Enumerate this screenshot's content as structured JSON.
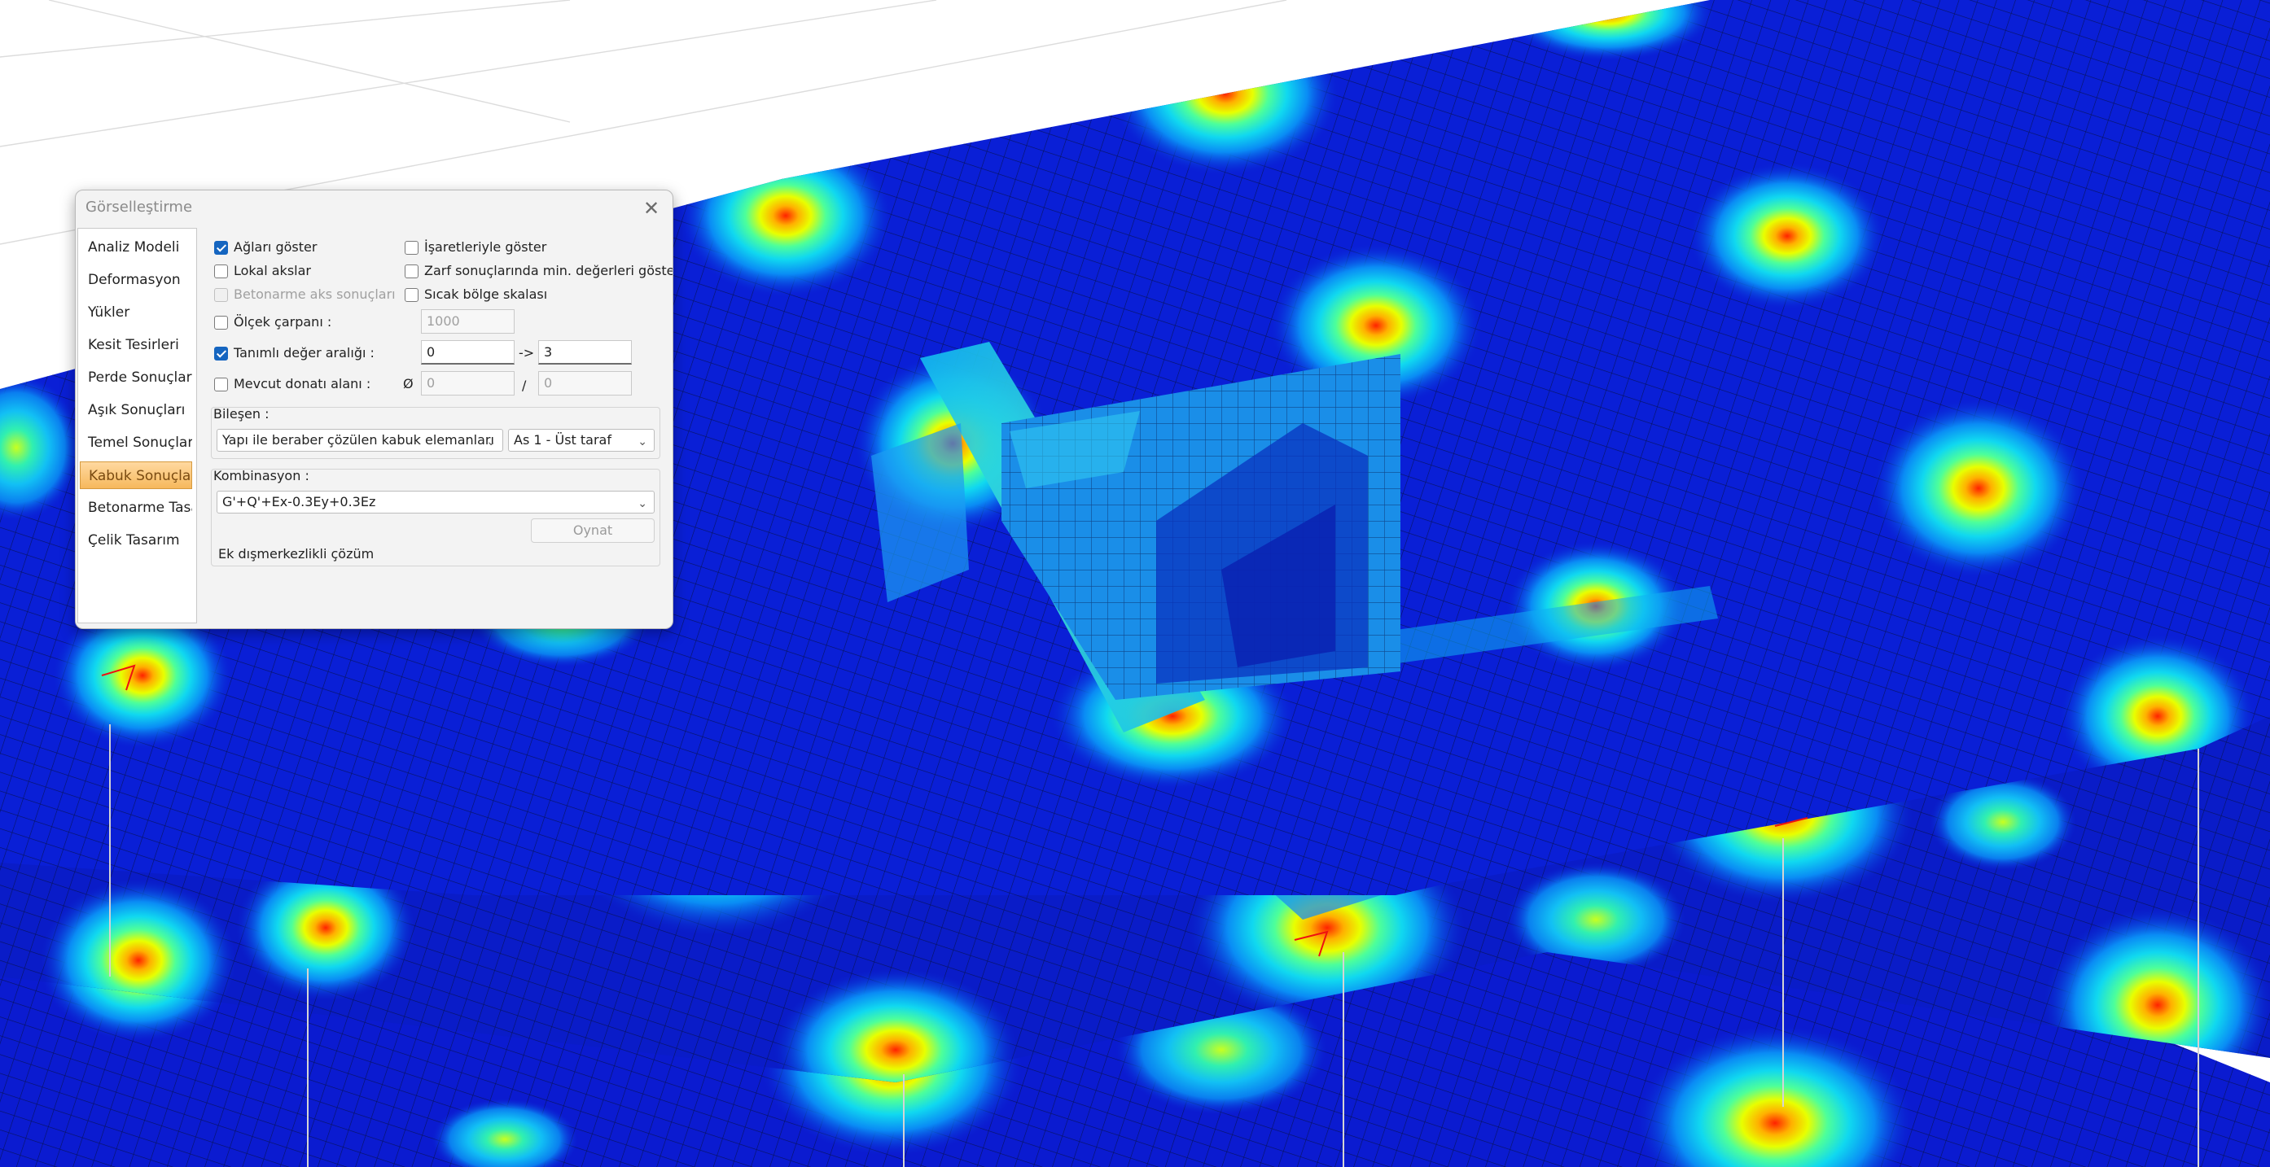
{
  "dialog": {
    "title": "Görselleştirme",
    "close_icon": "close-icon",
    "nav": [
      {
        "label": "Analiz Modeli",
        "active": false
      },
      {
        "label": "Deformasyon",
        "active": false
      },
      {
        "label": "Yükler",
        "active": false
      },
      {
        "label": "Kesit Tesirleri",
        "active": false
      },
      {
        "label": "Perde Sonuçları",
        "active": false
      },
      {
        "label": "Aşık Sonuçları",
        "active": false
      },
      {
        "label": "Temel Sonuçları",
        "active": false
      },
      {
        "label": "Kabuk Sonuçları",
        "active": true
      },
      {
        "label": "Betonarme Tasarım",
        "active": false
      },
      {
        "label": "Çelik Tasarım",
        "active": false
      }
    ],
    "options": {
      "show_mesh": {
        "label": "Ağları göster",
        "checked": true
      },
      "local_axes": {
        "label": "Lokal akslar",
        "checked": false
      },
      "rc_axis_results": {
        "label": "Betonarme aks sonuçları",
        "checked": false,
        "disabled": true
      },
      "show_with_signs": {
        "label": "İşaretleriyle göster",
        "checked": false
      },
      "envelope_min": {
        "label": "Zarf sonuçlarında min. değerleri göster",
        "checked": false
      },
      "hot_zone_scale": {
        "label": "Sıcak bölge skalası",
        "checked": false
      },
      "scale_factor": {
        "label": "Ölçek çarpanı :",
        "checked": false,
        "value": "1000"
      },
      "defined_range": {
        "label": "Tanımlı değer aralığı :",
        "checked": true,
        "from": "0",
        "arrow": "->",
        "to": "3"
      },
      "existing_rebar": {
        "label": "Mevcut donatı alanı :",
        "checked": false,
        "diameter_symbol": "Ø",
        "diameter": "0",
        "separator": "/",
        "spacing": "0"
      }
    },
    "component": {
      "title": "Bileşen :",
      "element_type": "Yapı ile beraber çözülen kabuk elemanları",
      "result": "As 1 - Üst taraf"
    },
    "combination": {
      "title": "Kombinasyon :",
      "value": "G'+Q'+Ex-0.3Ey+0.3Ez",
      "play_label": "Oynat",
      "extra_label": "Ek dışmerkezlikli çözüm"
    }
  },
  "colors": {
    "slab": "#0a1fd6",
    "wall": "#1e8ff0",
    "mesh_line": "#0a0f40",
    "accent": "#1565c0",
    "active_tab": "#f6b85d"
  }
}
